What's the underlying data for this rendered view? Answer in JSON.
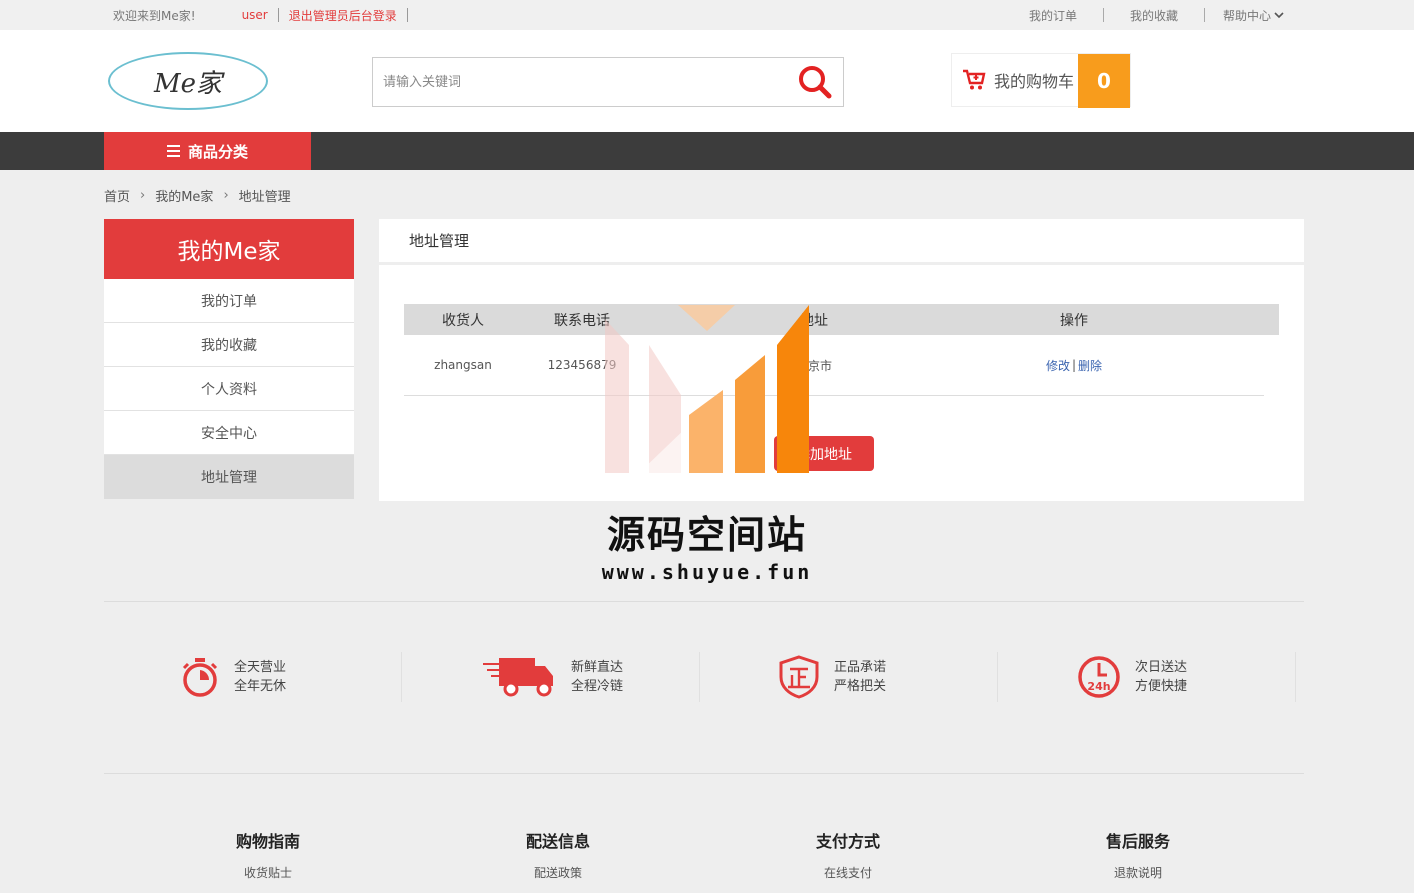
{
  "topbar": {
    "welcome": "欢迎来到Me家!",
    "username": "user",
    "logout": "退出管理员后台登录",
    "my_orders": "我的订单",
    "my_favorites": "我的收藏",
    "help_center": "帮助中心"
  },
  "header": {
    "logo_text": "Me家",
    "search_placeholder": "请输入关键词",
    "cart_label": "我的购物车",
    "cart_count": "0"
  },
  "nav": {
    "category_label": "商品分类"
  },
  "breadcrumb": {
    "items": [
      "首页",
      "我的Me家",
      "地址管理"
    ]
  },
  "sidebar": {
    "title": "我的Me家",
    "items": [
      "我的订单",
      "我的收藏",
      "个人资料",
      "安全中心",
      "地址管理"
    ],
    "active_index": 4
  },
  "main": {
    "title": "地址管理",
    "columns": [
      "收货人",
      "联系电话",
      "地址",
      "操作"
    ],
    "rows": [
      {
        "name": "zhangsan",
        "phone": "123456879",
        "address": "北京市",
        "edit": "修改",
        "sep": "|",
        "delete": "删除"
      }
    ],
    "add_button": "添加地址"
  },
  "watermark": {
    "title": "源码空间站",
    "url": "www.shuyue.fun"
  },
  "features": [
    {
      "line1": "全天营业",
      "line2": "全年无休",
      "icon": "stopwatch-icon"
    },
    {
      "line1": "新鲜直达",
      "line2": "全程冷链",
      "icon": "delivery-truck-icon"
    },
    {
      "line1": "正品承诺",
      "line2": "严格把关",
      "icon": "shield-genuine-icon"
    },
    {
      "line1": "次日送达",
      "line2": "方便快捷",
      "icon": "clock-24h-icon"
    }
  ],
  "footer": [
    {
      "heading": "购物指南",
      "link": "收货贴士"
    },
    {
      "heading": "配送信息",
      "link": "配送政策"
    },
    {
      "heading": "支付方式",
      "link": "在线支付"
    },
    {
      "heading": "售后服务",
      "link": "退款说明"
    }
  ],
  "colors": {
    "accent": "#e23c3c",
    "cart_count_bg": "#f89c1c",
    "nav_bg": "#3c3c3c",
    "link": "#3a64b0"
  }
}
